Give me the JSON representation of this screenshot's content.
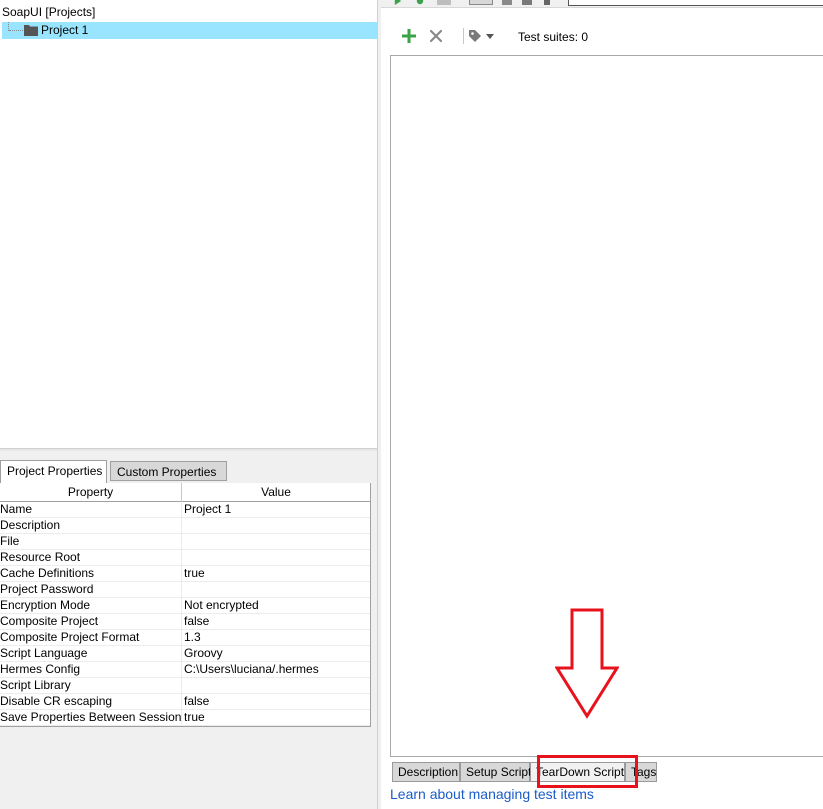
{
  "tree": {
    "root_label": "SoapUI [Projects]",
    "project_label": "Project 1"
  },
  "properties": {
    "tabs": [
      "Project Properties",
      "Custom Properties"
    ],
    "active_tab": "Project Properties",
    "columns": [
      "Property",
      "Value"
    ],
    "rows": [
      {
        "property": "Name",
        "value": "Project 1"
      },
      {
        "property": "Description",
        "value": ""
      },
      {
        "property": "File",
        "value": ""
      },
      {
        "property": "Resource Root",
        "value": ""
      },
      {
        "property": "Cache Definitions",
        "value": "true"
      },
      {
        "property": "Project Password",
        "value": ""
      },
      {
        "property": "Encryption Mode",
        "value": "Not encrypted"
      },
      {
        "property": "Composite Project",
        "value": "false"
      },
      {
        "property": "Composite Project Format",
        "value": "1.3"
      },
      {
        "property": "Script Language",
        "value": "Groovy"
      },
      {
        "property": "Hermes Config",
        "value": "C:\\Users\\luciana/.hermes"
      },
      {
        "property": "Script Library",
        "value": ""
      },
      {
        "property": "Disable CR escaping",
        "value": "false"
      },
      {
        "property": "Save Properties Between Sessions",
        "value": "true"
      }
    ]
  },
  "toolbar": {
    "add_icon": "plus-icon",
    "remove_icon": "x-icon",
    "tag_icon": "tag-dropdown-icon",
    "test_suites_label": "Test suites: 0"
  },
  "bottom_tabs": {
    "tabs": [
      "Description",
      "Setup Script",
      "TearDown Script",
      "Tags"
    ],
    "active_tab": "TearDown Script"
  },
  "learn_link": "Learn about managing test items",
  "colors": {
    "selection": "#99e5ff",
    "add_green": "#3aa34a",
    "annotation_red": "#e8121d",
    "link_blue": "#1a5cc8"
  }
}
